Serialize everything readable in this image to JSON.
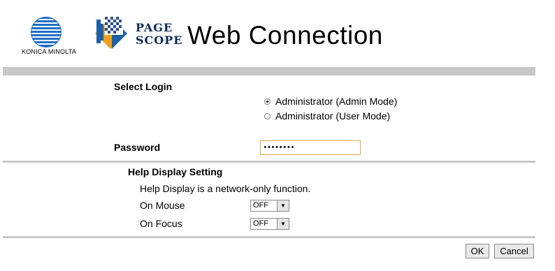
{
  "header": {
    "brand_text": "KONICA MINOLTA",
    "pagescope_line1": "PAGE",
    "pagescope_line2": "SCOPE",
    "product_title": "Web Connection"
  },
  "login": {
    "section_label": "Select Login",
    "options": [
      {
        "label": "Administrator (Admin Mode)",
        "selected": true
      },
      {
        "label": "Administrator (User Mode)",
        "selected": false
      }
    ],
    "password_label": "Password",
    "password_value": "••••••••"
  },
  "help": {
    "title": "Help Display Setting",
    "note": "Help Display is a network-only function.",
    "on_mouse_label": "On Mouse",
    "on_mouse_value": "OFF",
    "on_focus_label": "On Focus",
    "on_focus_value": "OFF"
  },
  "actions": {
    "ok_label": "OK",
    "cancel_label": "Cancel"
  },
  "colors": {
    "brand_blue": "#1e6fc3",
    "divider_gray": "#c8c8c8",
    "focus_border": "#d8a94c"
  }
}
